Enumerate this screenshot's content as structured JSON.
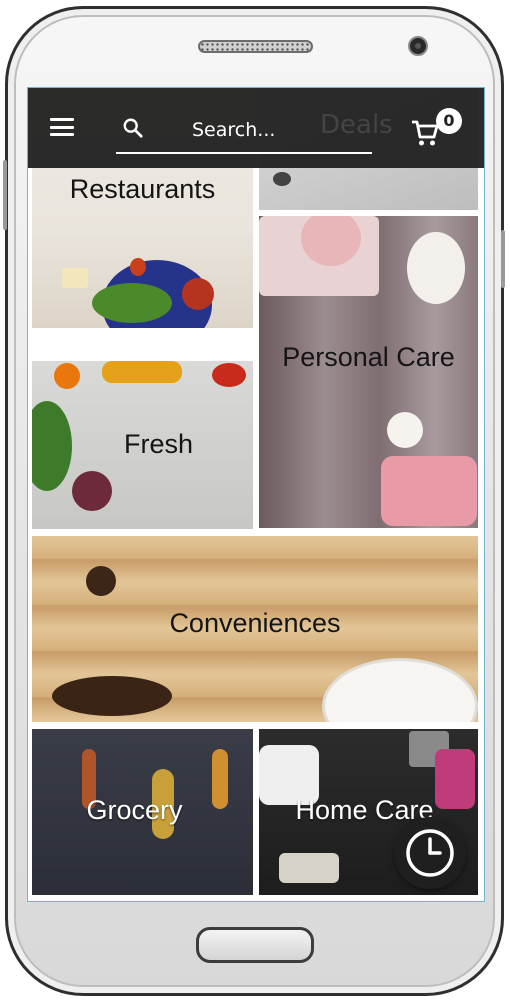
{
  "header": {
    "search_placeholder": "Search...",
    "behind_text": "Deals",
    "cart_count": "0",
    "icons": {
      "menu": "menu-icon",
      "search": "search-icon",
      "cart": "cart-icon"
    }
  },
  "categories": [
    {
      "label": "Restaurants"
    },
    {
      "label": "Personal Care"
    },
    {
      "label": "Fresh"
    },
    {
      "label": "Conveniences"
    },
    {
      "label": "Grocery"
    },
    {
      "label": "Home Care"
    }
  ],
  "fab": {
    "icon": "clock-icon"
  },
  "colors": {
    "topbar": "#222222",
    "wood": "#d9b98a",
    "badge": "#ffffff"
  }
}
